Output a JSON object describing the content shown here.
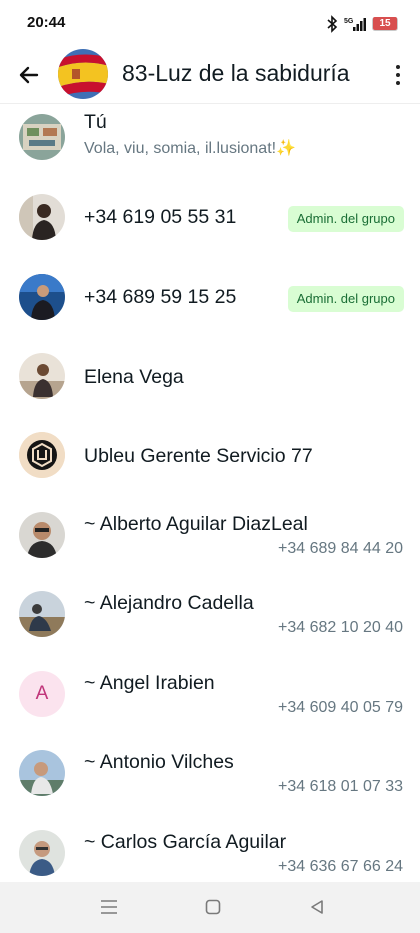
{
  "status_bar": {
    "time": "20:44",
    "network": "5G",
    "battery": "15"
  },
  "header": {
    "title": "83-Luz de la sabiduría"
  },
  "members": [
    {
      "name": "Tú",
      "sub": "Vola, viu, somia, il.lusionat!✨",
      "phone": "",
      "badge": ""
    },
    {
      "name": "+34 619 05 55 31",
      "sub": "",
      "phone": "",
      "badge": "Admin. del grupo"
    },
    {
      "name": "+34 689 59 15 25",
      "sub": "",
      "phone": "",
      "badge": "Admin. del grupo"
    },
    {
      "name": "Elena Vega",
      "sub": "",
      "phone": "",
      "badge": ""
    },
    {
      "name": "Ubleu Gerente Servicio 77",
      "sub": "",
      "phone": "",
      "badge": ""
    },
    {
      "name": "~ Alberto Aguilar DiazLeal",
      "sub": "",
      "phone": "+34 689 84 44 20",
      "badge": ""
    },
    {
      "name": "~ Alejandro Cadella",
      "sub": "",
      "phone": "+34 682 10 20 40",
      "badge": ""
    },
    {
      "name": "~ Angel Irabien",
      "sub": "",
      "phone": "+34 609 40 05 79",
      "badge": "",
      "initial": "A"
    },
    {
      "name": "~ Antonio Vilches",
      "sub": "",
      "phone": "+34 618 01 07 33",
      "badge": ""
    },
    {
      "name": "~ Carlos García Aguilar",
      "sub": "",
      "phone": "+34 636 67 66 24",
      "badge": ""
    }
  ],
  "colors": {
    "admin_badge_bg": "#d9fdd3",
    "admin_badge_text": "#1a6e35",
    "secondary_text": "#667781"
  }
}
